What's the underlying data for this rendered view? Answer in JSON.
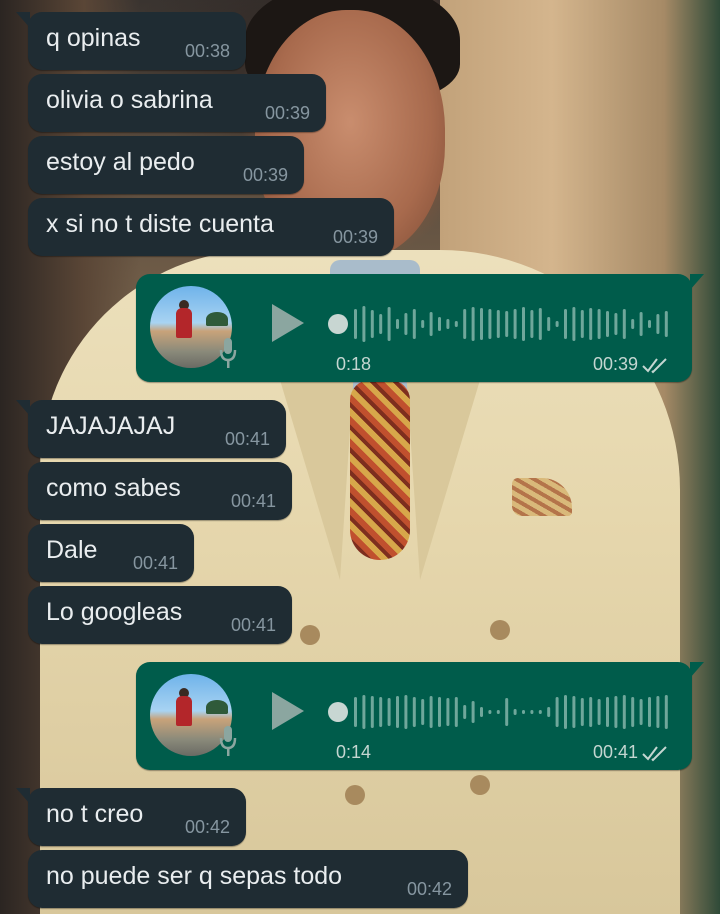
{
  "messages": [
    {
      "text": "q opinas",
      "time": "00:38"
    },
    {
      "text": "olivia o sabrina",
      "time": "00:39"
    },
    {
      "text": "estoy al pedo",
      "time": "00:39"
    },
    {
      "text": "x si no t diste cuenta",
      "time": "00:39"
    },
    {
      "text": "JAJAJAJAJ",
      "time": "00:41"
    },
    {
      "text": "como sabes",
      "time": "00:41"
    },
    {
      "text": "Dale",
      "time": "00:41"
    },
    {
      "text": "Lo googleas",
      "time": "00:41"
    },
    {
      "text": "no t creo",
      "time": "00:42"
    },
    {
      "text": "no puede ser q sepas todo",
      "time": "00:42"
    }
  ],
  "voice_notes": [
    {
      "duration": "0:18",
      "time": "00:39",
      "status": "delivered"
    },
    {
      "duration": "0:14",
      "time": "00:41",
      "status": "delivered"
    }
  ],
  "colors": {
    "incoming_bubble": "#1f2c33",
    "outgoing_bubble": "#005c4b",
    "timestamp": "#8696a0"
  },
  "icons": {
    "play": "play-icon",
    "mic": "mic-icon",
    "ticks": "double-check-icon"
  }
}
